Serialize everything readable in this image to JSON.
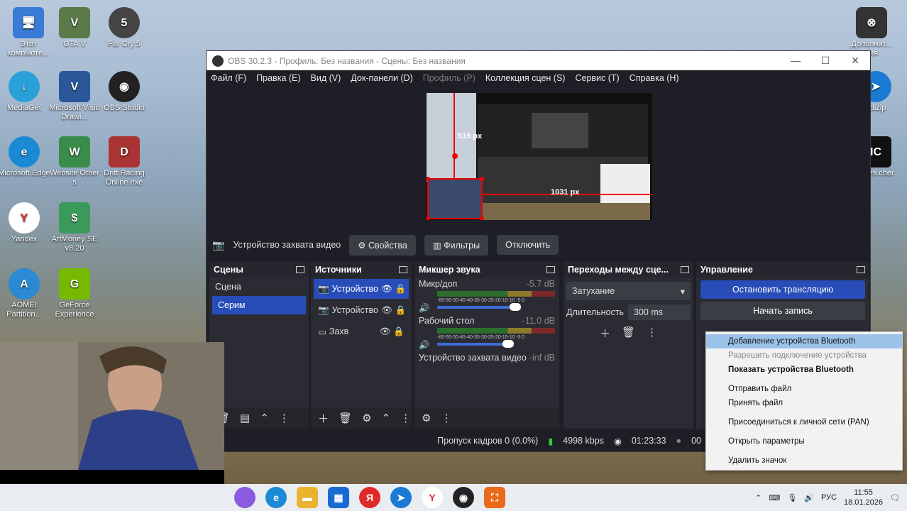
{
  "desktop": {
    "icons": [
      {
        "label": "Этот компьюте...",
        "color": "#3a7bd5"
      },
      {
        "label": "GTA V",
        "color": "#5a7a4a"
      },
      {
        "label": "Far Cry 5",
        "color": "#444"
      },
      {
        "label": "MediaGet",
        "color": "#2aa0d8"
      },
      {
        "label": "Microsoft Visio Drawi...",
        "color": "#2b579a"
      },
      {
        "label": "OBS Studio",
        "color": "#222"
      },
      {
        "label": "Microsoft Edge",
        "color": "#1a8ad4"
      },
      {
        "label": "Website Other s",
        "color": "#3a8c4a"
      },
      {
        "label": "Drift Racing Online.exe",
        "color": "#a33"
      },
      {
        "label": "Yandex",
        "color": "#e02a2a"
      },
      {
        "label": "ArtMoney SE v8.20",
        "color": "#3a9a5a"
      },
      {
        "label": "AOMEI Partition...",
        "color": "#2a8ad4"
      },
      {
        "label": "GeForce Experience",
        "color": "#76b900"
      }
    ],
    "right_icons": [
      {
        "label": "Дополнит... ния"
      },
      {
        "label": "edizip"
      },
      {
        "label": "ames cher"
      }
    ]
  },
  "obs": {
    "title": "OBS 30.2.3 - Профиль: Без названия - Сцены: Без названия",
    "menu": [
      "Файл (F)",
      "Правка (E)",
      "Вид (V)",
      "Док-панели (D)",
      "Профиль (P)",
      "Коллекция сцен (S)",
      "Сервис (T)",
      "Справка (H)"
    ],
    "preview": {
      "label_v": "515 px",
      "label_h": "1031 px"
    },
    "source_bar": {
      "name": "Устройство захвата видео",
      "props": "Свойства",
      "filters": "Фильтры",
      "disable": "Отключить"
    },
    "scenes": {
      "title": "Сцены",
      "items": [
        "Сцена",
        "Серим"
      ]
    },
    "sources": {
      "title": "Источники",
      "items": [
        "Устройство",
        "Устройство",
        "Захв"
      ]
    },
    "mixer": {
      "title": "Микшер звука",
      "scale": "-60-55-50-45-40-35-30-25-20-15-10 -5  0",
      "channels": [
        {
          "name": "Микр/доп",
          "db": "-5.7 dB"
        },
        {
          "name": "Рабочий стол",
          "db": "-11.0 dB"
        },
        {
          "name": "Устройство захвата видео",
          "db": "-inf dB"
        }
      ]
    },
    "transitions": {
      "title": "Переходы между сце...",
      "type": "Затухание",
      "duration_label": "Длительность",
      "duration": "300 ms"
    },
    "controls": {
      "title": "Управление",
      "stop_stream": "Остановить трансляцию",
      "start_rec": "Начать запись"
    },
    "status": {
      "dropped": "Пропуск кадров 0 (0.0%)",
      "bitrate": "4998 kbps",
      "time": "01:23:33",
      "rec": "00"
    }
  },
  "context_menu": {
    "items": [
      {
        "label": "Добавление устройства Bluetooth",
        "state": "highlight"
      },
      {
        "label": "Разрешить подключение устройства",
        "state": "disabled"
      },
      {
        "label": "Показать устройства Bluetooth",
        "state": "bold"
      },
      {
        "label": "Отправить файл",
        "state": "normal"
      },
      {
        "label": "Принять файл",
        "state": "normal"
      },
      {
        "label": "Присоединиться к личной сети (PAN)",
        "state": "normal"
      },
      {
        "label": "Открыть параметры",
        "state": "normal"
      },
      {
        "label": "Удалить значок",
        "state": "normal"
      }
    ]
  },
  "taskbar": {
    "lang": "РУС",
    "time": "11:55",
    "date": "18.01.2026"
  }
}
